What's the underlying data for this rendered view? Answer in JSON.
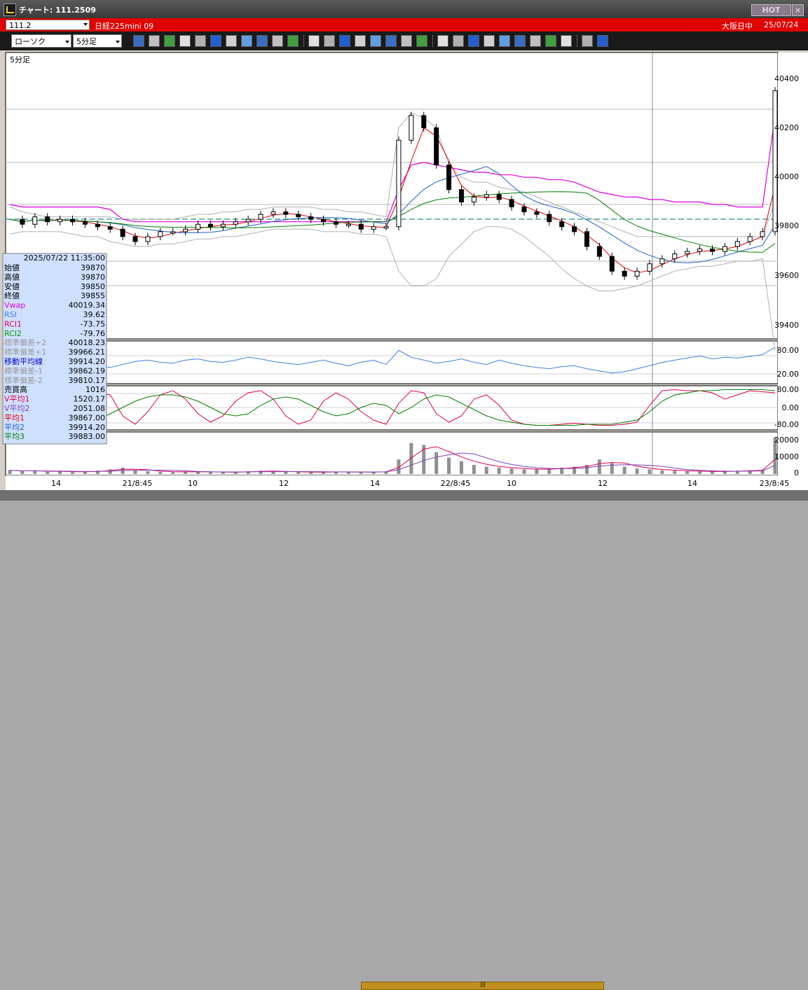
{
  "window": {
    "title": "チャート: 111.2509",
    "hot_label": "HOT",
    "close_label": "×"
  },
  "infobar": {
    "code": "111.2",
    "symbol": "日経225mini 09",
    "market": "大阪日中",
    "date": "25/07/24"
  },
  "toolbar": {
    "chart_type": "ローソク",
    "interval": "5分足",
    "buttons": [
      "zoom",
      "window",
      "pen",
      "link",
      "cursor",
      "arrow",
      "memo",
      "trash",
      "bar-chart",
      "bar-chart-2",
      "ALL",
      "settings",
      "wrench",
      "color",
      "sell",
      "search",
      "board",
      "flag",
      "disabled",
      "MA",
      "MR",
      "BB",
      "MAE",
      "HL",
      "ATR",
      "PR",
      "PVT",
      "box",
      "Log",
      "export"
    ]
  },
  "chart_label": "5分足",
  "price_axis": [
    "40400",
    "40200",
    "40000",
    "39800",
    "39600",
    "39400"
  ],
  "rsi_axis": [
    "80.00",
    "20.00"
  ],
  "rci_axis": [
    "80.00",
    "0.00",
    "-80.00"
  ],
  "volume_axis": [
    "20000",
    "10000",
    "0"
  ],
  "time_axis": [
    {
      "label": "14",
      "x": 80
    },
    {
      "label": "21/8:45",
      "x": 196
    },
    {
      "label": "10",
      "x": 275
    },
    {
      "label": "12",
      "x": 405
    },
    {
      "label": "14",
      "x": 535
    },
    {
      "label": "22/8:45",
      "x": 650
    },
    {
      "label": "10",
      "x": 730
    },
    {
      "label": "12",
      "x": 860
    },
    {
      "label": "14",
      "x": 988
    },
    {
      "label": "23/8:45",
      "x": 1105
    }
  ],
  "legend": {
    "datetime": "2025/07/22  11:35:00",
    "rows": [
      {
        "label": "始値",
        "value": "39870",
        "color": "#000000"
      },
      {
        "label": "高値",
        "value": "39870",
        "color": "#000000"
      },
      {
        "label": "安値",
        "value": "39850",
        "color": "#000000"
      },
      {
        "label": "終値",
        "value": "39855",
        "color": "#000000"
      },
      {
        "label": "Vwap",
        "value": "40019.34",
        "color": "#dd00dd"
      },
      {
        "label": "RSI",
        "value": "39.62",
        "color": "#4080ff"
      },
      {
        "label": "RCI1",
        "value": "-73.75",
        "color": "#e0004c"
      },
      {
        "label": "RCI2",
        "value": "-79.76",
        "color": "#00a000"
      },
      {
        "label": "標準偏差+2",
        "value": "40018.23",
        "color": "#999999"
      },
      {
        "label": "標準偏差+1",
        "value": "39966.21",
        "color": "#999999"
      },
      {
        "label": "移動平均線",
        "value": "39914.20",
        "color": "#0000cc"
      },
      {
        "label": "標準偏差-1",
        "value": "39862.19",
        "color": "#999999"
      },
      {
        "label": "標準偏差-2",
        "value": "39810.17",
        "color": "#999999"
      },
      {
        "label": "売買高",
        "value": "1016",
        "color": "#000000"
      },
      {
        "label": "V平均1",
        "value": "1520.17",
        "color": "#e0004c"
      },
      {
        "label": "V平均2",
        "value": "2051.08",
        "color": "#8040c0"
      },
      {
        "label": "平均1",
        "value": "39867.00",
        "color": "#e00000"
      },
      {
        "label": "平均2",
        "value": "39914.20",
        "color": "#2060c0"
      },
      {
        "label": "平均3",
        "value": "39883.00",
        "color": "#008000"
      }
    ]
  },
  "chart_data": {
    "type": "candlestick",
    "y_range": [
      39400,
      40400
    ],
    "closes": [
      39830,
      39810,
      39840,
      39820,
      39830,
      39820,
      39810,
      39800,
      39790,
      39760,
      39740,
      39760,
      39780,
      39780,
      39790,
      39810,
      39800,
      39810,
      39820,
      39830,
      39850,
      39860,
      39850,
      39840,
      39830,
      39820,
      39810,
      39810,
      39790,
      39800,
      39800,
      40150,
      40250,
      40200,
      40050,
      39950,
      39900,
      39920,
      39930,
      39910,
      39880,
      39860,
      39850,
      39820,
      39800,
      39780,
      39720,
      39680,
      39620,
      39600,
      39620,
      39650,
      39670,
      39690,
      39700,
      39710,
      39700,
      39720,
      39740,
      39760,
      39780,
      40350
    ],
    "bb_upper": [
      39880,
      39860,
      39850,
      39840,
      39840,
      39840,
      39840,
      39840,
      39840,
      39830,
      39830,
      39830,
      39830,
      39830,
      39840,
      39850,
      39850,
      39860,
      39860,
      39870,
      39870,
      39880,
      39880,
      39880,
      39880,
      39870,
      39870,
      39860,
      39860,
      39850,
      39840,
      40200,
      40260,
      40240,
      40200,
      40050,
      40000,
      39980,
      39980,
      39960,
      39950,
      39940,
      39920,
      39900,
      39880,
      39860,
      39840,
      39820,
      39800,
      39780,
      39760,
      39760,
      39760,
      39760,
      39760,
      39760,
      39760,
      39760,
      39760,
      39760,
      39760,
      39900
    ],
    "bb_lower": [
      39770,
      39780,
      39780,
      39780,
      39780,
      39770,
      39760,
      39760,
      39740,
      39730,
      39720,
      39720,
      39730,
      39730,
      39740,
      39750,
      39750,
      39760,
      39760,
      39770,
      39780,
      39790,
      39790,
      39790,
      39790,
      39780,
      39780,
      39780,
      39770,
      39770,
      39760,
      39620,
      39560,
      39560,
      39590,
      39680,
      39730,
      39780,
      39800,
      39800,
      39790,
      39760,
      39720,
      39680,
      39630,
      39590,
      39560,
      39540,
      39540,
      39550,
      39560,
      39580,
      39600,
      39620,
      39630,
      39640,
      39640,
      39650,
      39660,
      39660,
      39670,
      39300
    ],
    "vwap": [
      39890,
      39880,
      39880,
      39880,
      39880,
      39880,
      39880,
      39880,
      39870,
      39830,
      39820,
      39820,
      39820,
      39820,
      39820,
      39820,
      39820,
      39820,
      39820,
      39820,
      39820,
      39820,
      39820,
      39820,
      39820,
      39820,
      39820,
      39820,
      39820,
      39820,
      39820,
      39950,
      40050,
      40060,
      40050,
      40040,
      40030,
      40020,
      40020,
      40010,
      40010,
      40000,
      40000,
      39990,
      39990,
      39980,
      39960,
      39940,
      39930,
      39920,
      39920,
      39910,
      39910,
      39900,
      39900,
      39900,
      39890,
      39890,
      39880,
      39880,
      39880,
      40250
    ],
    "rsi": [
      55,
      58,
      50,
      45,
      55,
      52,
      48,
      42,
      38,
      45,
      52,
      55,
      50,
      48,
      55,
      58,
      52,
      50,
      55,
      62,
      58,
      52,
      48,
      45,
      50,
      55,
      48,
      42,
      50,
      55,
      45,
      78,
      62,
      55,
      48,
      52,
      58,
      50,
      45,
      55,
      48,
      42,
      38,
      35,
      40,
      42,
      35,
      30,
      25,
      28,
      35,
      42,
      50,
      55,
      60,
      65,
      58,
      62,
      60,
      64,
      68,
      85
    ],
    "rci1": [
      -20,
      40,
      60,
      -30,
      -80,
      -60,
      20,
      70,
      60,
      -40,
      -80,
      -20,
      60,
      80,
      40,
      -30,
      -70,
      -40,
      30,
      70,
      80,
      40,
      -40,
      -80,
      -60,
      30,
      70,
      40,
      -20,
      -60,
      -80,
      20,
      80,
      70,
      -30,
      -70,
      -40,
      40,
      60,
      10,
      -60,
      -80,
      -85,
      -85,
      -80,
      -75,
      -80,
      -85,
      -85,
      -80,
      -70,
      10,
      80,
      85,
      80,
      80,
      70,
      40,
      60,
      80,
      75,
      70
    ],
    "rci2": [
      -10,
      10,
      30,
      20,
      -20,
      -50,
      -70,
      -60,
      -30,
      0,
      30,
      50,
      60,
      60,
      50,
      30,
      0,
      -30,
      -40,
      -30,
      10,
      40,
      50,
      40,
      10,
      -20,
      -40,
      -30,
      0,
      20,
      10,
      -30,
      0,
      40,
      60,
      50,
      20,
      -10,
      -40,
      -60,
      -70,
      -80,
      -85,
      -85,
      -85,
      -85,
      -80,
      -80,
      -80,
      -70,
      -60,
      -20,
      30,
      60,
      70,
      80,
      80,
      85,
      85,
      85,
      85,
      80
    ],
    "volume": [
      2000,
      1500,
      1800,
      1200,
      1500,
      1000,
      1300,
      1800,
      2500,
      3500,
      2000,
      1500,
      1200,
      1000,
      1400,
      1200,
      1000,
      900,
      1100,
      1500,
      1800,
      1400,
      1200,
      1000,
      900,
      1100,
      1400,
      1000,
      900,
      1200,
      1500,
      8000,
      17000,
      16000,
      12000,
      9000,
      7000,
      5000,
      4000,
      3500,
      3000,
      2500,
      2500,
      3000,
      3500,
      4000,
      5000,
      8000,
      6000,
      4000,
      3000,
      2500,
      2000,
      1800,
      1500,
      1400,
      1300,
      1500,
      1800,
      2000,
      2200,
      20000
    ],
    "volume_range": [
      0,
      20000
    ]
  }
}
